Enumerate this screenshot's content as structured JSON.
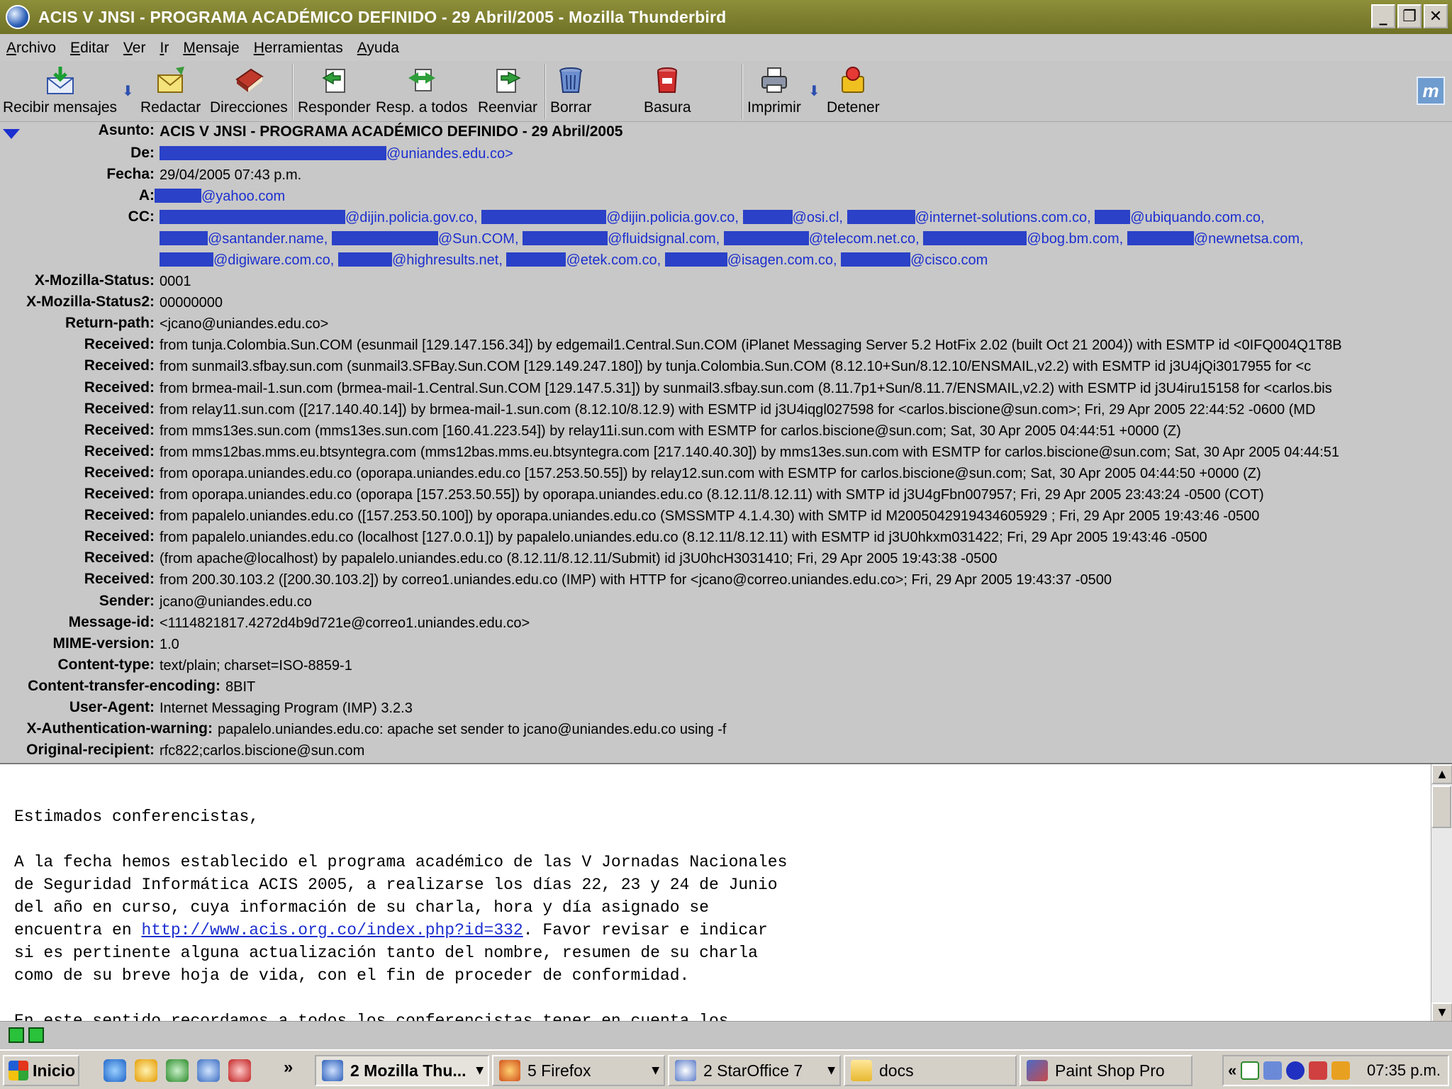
{
  "window": {
    "title": "ACIS V JNSI - PROGRAMA ACADÉMICO DEFINIDO - 29 Abril/2005 - Mozilla Thunderbird",
    "minimize": "_",
    "restore": "❐",
    "close": "✕"
  },
  "menu": [
    "Archivo",
    "Editar",
    "Ver",
    "Ir",
    "Mensaje",
    "Herramientas",
    "Ayuda"
  ],
  "toolbar": {
    "get_mail": "Recibir mensajes",
    "compose": "Redactar",
    "address_book": "Direcciones",
    "reply": "Responder",
    "reply_all": "Resp. a todos",
    "forward": "Reenviar",
    "delete": "Borrar",
    "junk": "Basura",
    "print": "Imprimir",
    "stop": "Detener",
    "dropdown_arrow": "⬇",
    "throbber": "m"
  },
  "headers": {
    "subject_label": "Asunto:",
    "subject": "ACIS V JNSI - PROGRAMA ACADÉMICO DEFINIDO - 29 Abril/2005",
    "from_label": "De:",
    "from": "@uniandes.edu.co>",
    "date_label": "Fecha:",
    "date": "29/04/2005 07:43 p.m.",
    "to_label": "A:",
    "to": "@yahoo.com",
    "cc_label": "CC:",
    "cc": [
      [
        "@dijin.policia.gov.co,",
        "@dijin.policia.gov.co,",
        "@osi.cl,",
        "@internet-solutions.com.co,",
        "@ubiquando.com.co,"
      ],
      [
        "@santander.name,",
        "@Sun.COM,",
        "@fluidsignal.com,",
        "@telecom.net.co,",
        "@bog.bm.com,",
        "@newnetsa.com,"
      ],
      [
        "@digiware.com.co,",
        "@highresults.net,",
        "@etek.com.co,",
        "@isagen.com.co,",
        "@cisco.com"
      ]
    ],
    "fields": [
      {
        "label": "X-Mozilla-Status:",
        "value": "0001"
      },
      {
        "label": "X-Mozilla-Status2:",
        "value": "00000000"
      },
      {
        "label": "Return-path:",
        "value": "<jcano@uniandes.edu.co>"
      },
      {
        "label": "Received:",
        "value": "from tunja.Colombia.Sun.COM (esunmail [129.147.156.34]) by edgemail1.Central.Sun.COM (iPlanet Messaging Server 5.2 HotFix 2.02 (built Oct 21 2004)) with ESMTP id <0IFQ004Q1T8B"
      },
      {
        "label": "Received:",
        "value": "from sunmail3.sfbay.sun.com (sunmail3.SFBay.Sun.COM [129.149.247.180])  by tunja.Colombia.Sun.COM (8.12.10+Sun/8.12.10/ENSMAIL,v2.2) with ESMTP id j3U4jQi3017955      for <c"
      },
      {
        "label": "Received:",
        "value": "from brmea-mail-1.sun.com (brmea-mail-1.Central.Sun.COM [129.147.5.31]) by sunmail3.sfbay.sun.com (8.11.7p1+Sun/8.11.7/ENSMAIL,v2.2) with ESMTP id j3U4iru15158 for <carlos.bis"
      },
      {
        "label": "Received:",
        "value": "from relay11.sun.com ([217.140.40.14])  by brmea-mail-1.sun.com (8.12.10/8.12.9) with ESMTP id j3U4iqgl027598    for <carlos.biscione@sun.com>; Fri, 29 Apr 2005 22:44:52 -0600 (MD"
      },
      {
        "label": "Received:",
        "value": "from mms13es.sun.com (mms13es.sun.com [160.41.223.54]) by relay11i.sun.com with ESMTP for carlos.biscione@sun.com; Sat, 30 Apr 2005 04:44:51 +0000 (Z)"
      },
      {
        "label": "Received:",
        "value": "from mms12bas.mms.eu.btsyntegra.com (mms12bas.mms.eu.btsyntegra.com [217.140.40.30]) by mms13es.sun.com with ESMTP for carlos.biscione@sun.com; Sat, 30 Apr 2005 04:44:51"
      },
      {
        "label": "Received:",
        "value": "from oporapa.uniandes.edu.co (oporapa.uniandes.edu.co [157.253.50.55]) by relay12.sun.com with ESMTP for carlos.biscione@sun.com; Sat, 30 Apr 2005 04:44:50 +0000 (Z)"
      },
      {
        "label": "Received:",
        "value": "from oporapa.uniandes.edu.co (oporapa [157.253.50.55])  by oporapa.uniandes.edu.co (8.12.11/8.12.11) with SMTP id j3U4gFbn007957; Fri, 29 Apr 2005 23:43:24 -0500 (COT)"
      },
      {
        "label": "Received:",
        "value": "from papalelo.uniandes.edu.co ([157.253.50.100]) by oporapa.uniandes.edu.co (SMSSMTP 4.1.4.30) with SMTP id M2005042919434605929 ; Fri, 29 Apr 2005 19:43:46 -0500"
      },
      {
        "label": "Received:",
        "value": "from papalelo.uniandes.edu.co (localhost [127.0.0.1])   by papalelo.uniandes.edu.co (8.12.11/8.12.11) with ESMTP id j3U0hkxm031422; Fri, 29 Apr 2005 19:43:46 -0500"
      },
      {
        "label": "Received:",
        "value": "(from apache@localhost) by papalelo.uniandes.edu.co (8.12.11/8.12.11/Submit) id j3U0hcH3031410; Fri, 29 Apr 2005 19:43:38 -0500"
      },
      {
        "label": "Received:",
        "value": "from 200.30.103.2 ([200.30.103.2])       by correo1.uniandes.edu.co (IMP) with HTTP      for <jcano@correo.uniandes.edu.co>; Fri, 29 Apr 2005 19:43:37 -0500"
      },
      {
        "label": "Sender:",
        "value": "jcano@uniandes.edu.co"
      },
      {
        "label": "Message-id:",
        "value": "<1114821817.4272d4b9d721e@correo1.uniandes.edu.co>"
      },
      {
        "label": "MIME-version:",
        "value": "1.0"
      },
      {
        "label": "Content-type:",
        "value": "text/plain; charset=ISO-8859-1"
      },
      {
        "label": "Content-transfer-encoding:",
        "value": "8BIT"
      },
      {
        "label": "User-Agent:",
        "value": "Internet Messaging Program (IMP) 3.2.3"
      },
      {
        "label": "X-Authentication-warning:",
        "value": "papalelo.uniandes.edu.co: apache set sender to jcano@uniandes.edu.co using -f"
      },
      {
        "label": "Original-recipient:",
        "value": "rfc822;carlos.biscione@sun.com"
      }
    ]
  },
  "body": {
    "greeting": "Estimados conferencistas,",
    "p1_l1": "A la fecha hemos establecido el programa académico de las V Jornadas Nacionales",
    "p1_l2": "de Seguridad Informática ACIS 2005, a realizarse los días 22, 23 y 24 de Junio",
    "p1_l3": "del año en curso, cuya información de su charla, hora y día asignado se",
    "p1_l4a": "encuentra en ",
    "url": "http://www.acis.org.co/index.php?id=332",
    "p1_l4b": ". Favor revisar e indicar",
    "p1_l5": "si es pertinente alguna actualización tanto del nombre, resumen de su charla",
    "p1_l6": "como de su breve hoja de vida, con el fin de proceder de conformidad.",
    "p2_partial": "En este sentido recordamos a todos los conferencistas tener en cuenta los"
  },
  "taskbar": {
    "start": "Inicio",
    "more": "»",
    "tasks": [
      {
        "label": "2 Mozilla Thu...",
        "caret": "▼"
      },
      {
        "label": "5 Firefox",
        "caret": "▼"
      },
      {
        "label": "2 StarOffice 7",
        "caret": "▼"
      },
      {
        "label": "docs",
        "caret": ""
      },
      {
        "label": "Paint Shop Pro",
        "caret": ""
      }
    ],
    "tray_more": "«",
    "clock": "07:35 p.m."
  }
}
